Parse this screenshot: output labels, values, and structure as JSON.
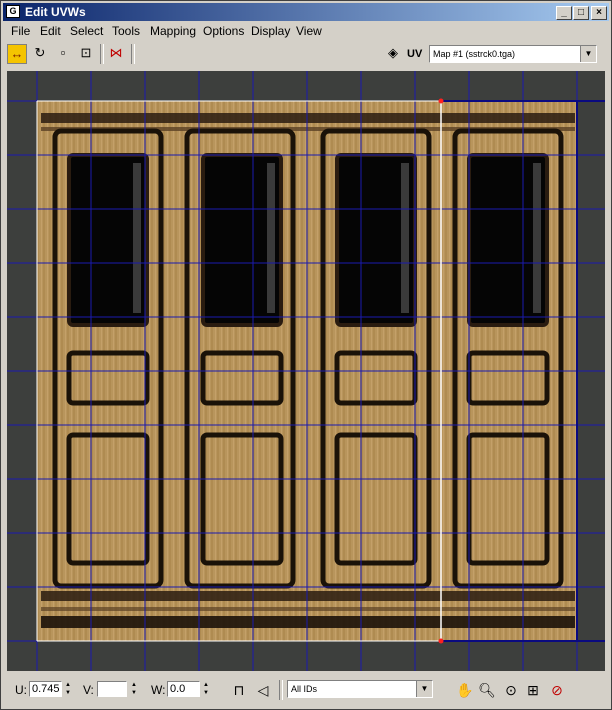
{
  "window": {
    "title": "Edit UVWs",
    "app_icon": "editor-app-icon"
  },
  "menu": [
    "File",
    "Edit",
    "Select",
    "Tools",
    "Mapping",
    "Options",
    "Display",
    "View"
  ],
  "toolbar": {
    "uv_label": "UV",
    "map_dropdown": "Map #1 (sstrck0.tga)"
  },
  "status": {
    "u_label": "U:",
    "u_value": "0.745",
    "v_label": "V:",
    "v_value": "",
    "w_label": "W:",
    "w_value": "0.0",
    "ids_dropdown": "All IDs"
  },
  "colors": {
    "grid": "#1a1ab0",
    "viewport_bg": "#3d3f3d",
    "wood": "#b8955c",
    "title_start": "#0a246a"
  }
}
